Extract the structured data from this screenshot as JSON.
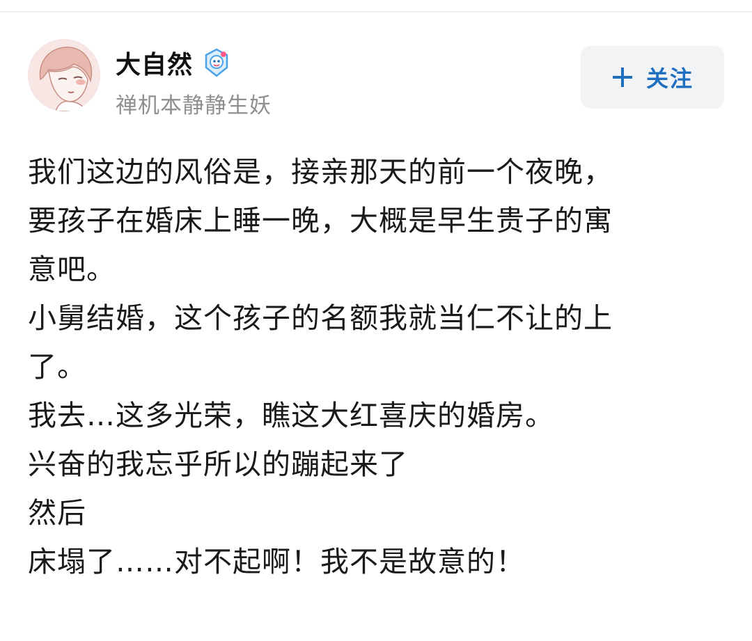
{
  "user": {
    "name": "大自然",
    "bio": "禅机本静静生妖",
    "avatar_icon": "avatar-illustration",
    "badge_icon": "member-badge-icon"
  },
  "follow_button": {
    "icon": "plus-icon",
    "label": "关注",
    "color": "#1e6fbf"
  },
  "post": {
    "lines": [
      "我们这边的风俗是，接亲那天的前一个夜晚，",
      "要孩子在婚床上睡一晚，大概是早生贵子的寓",
      "意吧。",
      "小舅结婚，这个孩子的名额我就当仁不让的上",
      "了。",
      "我去…这多光荣，瞧这大红喜庆的婚房。",
      "兴奋的我忘乎所以的蹦起来了",
      "然后",
      "床塌了……对不起啊！我不是故意的！"
    ]
  }
}
